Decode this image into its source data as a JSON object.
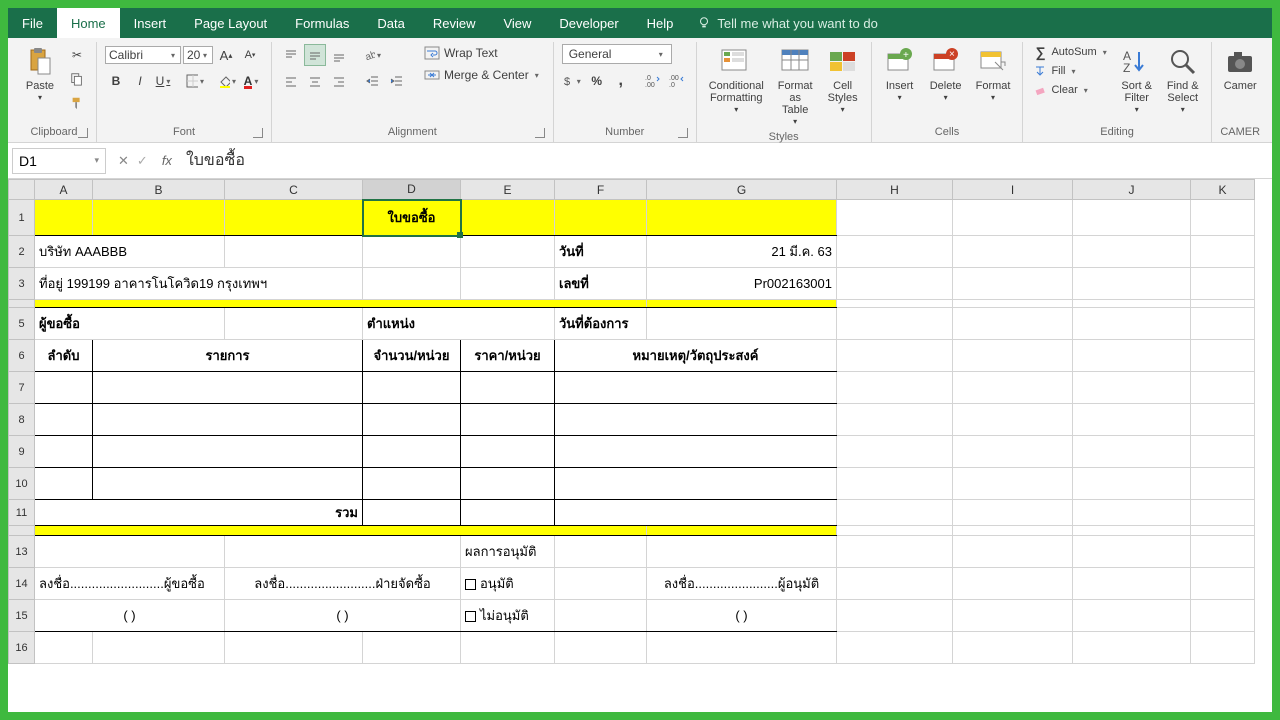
{
  "menu": {
    "items": [
      "File",
      "Home",
      "Insert",
      "Page Layout",
      "Formulas",
      "Data",
      "Review",
      "View",
      "Developer",
      "Help"
    ],
    "active": "Home",
    "tellMe": "Tell me what you want to do"
  },
  "ribbon": {
    "clipboard": {
      "paste": "Paste",
      "label": "Clipboard"
    },
    "font": {
      "name": "Calibri",
      "size": "20",
      "label": "Font",
      "bold": "B",
      "italic": "I",
      "underline": "U"
    },
    "alignment": {
      "label": "Alignment",
      "wrap": "Wrap Text",
      "merge": "Merge & Center"
    },
    "number": {
      "label": "Number",
      "format": "General"
    },
    "styles": {
      "label": "Styles",
      "cond": "Conditional\nFormatting",
      "table": "Format as\nTable",
      "cell": "Cell\nStyles"
    },
    "cells": {
      "label": "Cells",
      "insert": "Insert",
      "delete": "Delete",
      "format": "Format"
    },
    "editing": {
      "label": "Editing",
      "autosum": "AutoSum",
      "fill": "Fill",
      "clear": "Clear",
      "sort": "Sort &\nFilter",
      "find": "Find &\nSelect"
    },
    "camera": {
      "label": "CAMER",
      "btn": "Camer"
    }
  },
  "formula": {
    "nameBox": "D1",
    "value": "ใบขอซื้อ"
  },
  "cols": [
    "A",
    "B",
    "C",
    "D",
    "E",
    "F",
    "G",
    "H",
    "I",
    "J",
    "K"
  ],
  "sheet": {
    "title": "ใบขอซื้อ",
    "company": "บริษัท AAABBB",
    "address": "ที่อยู่ 199199 อาคารโนโควิด19 กรุงเทพฯ",
    "dateLabel": "วันที่",
    "dateValue": "21 มี.ค. 63",
    "docNoLabel": "เลขที่",
    "docNoValue": "Pr002163001",
    "requesterLabel": "ผู้ขอซื้อ",
    "positionLabel": "ตำแหน่ง",
    "reqDateLabel": "วันที่ต้องการ",
    "colNo": "ลำดับ",
    "colItem": "รายการ",
    "colQty": "จำนวน/หน่วย",
    "colPrice": "ราคา/หน่วย",
    "colRemark": "หมายเหตุ/วัตถุประสงค์",
    "total": "รวม",
    "resultLabel": "ผลการอนุมัติ",
    "sign1": "ลงชื่อ..........................ผู้ขอซื้อ",
    "sign2": "ลงชื่อ.........................ฝ่ายจัดซื้อ",
    "sign3": "ลงชื่อ.......................ผู้อนุมัติ",
    "approve": "อนุมัติ",
    "notApprove": "ไม่อนุมัติ",
    "paren1": "(                              )",
    "paren2": "(                                    )",
    "paren3": "(                                    )"
  }
}
